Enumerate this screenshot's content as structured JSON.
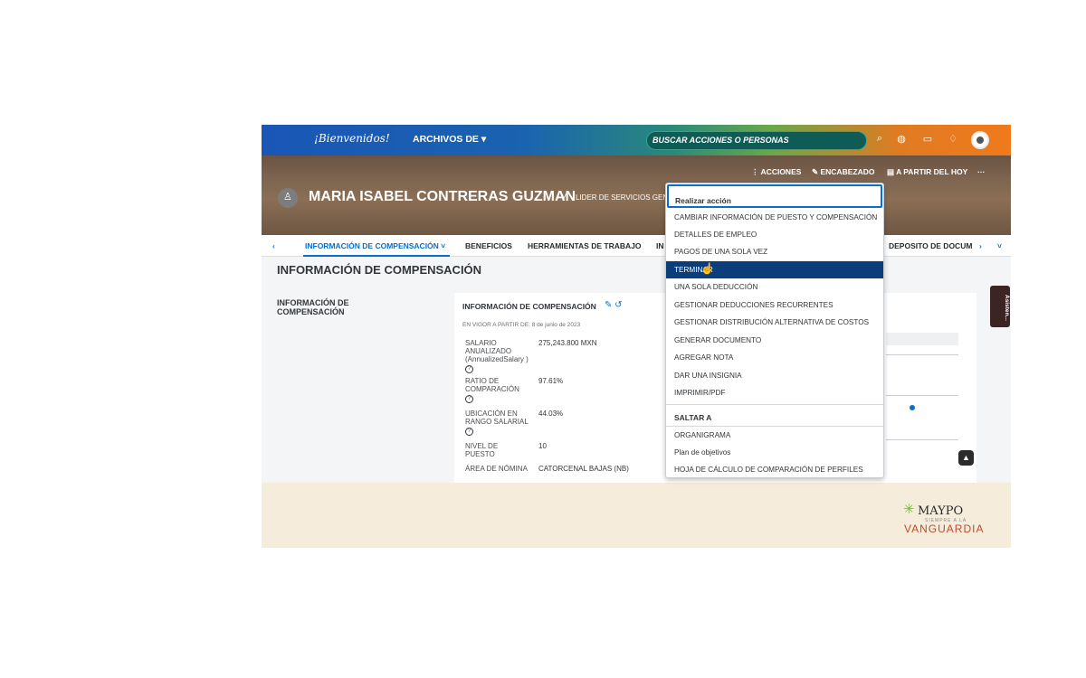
{
  "topbar": {
    "logo": "¡Bienvenidos!",
    "menu_label": "ARCHIVOS DE ▾",
    "search_placeholder": "BUSCAR ACCIONES O PERSONAS",
    "icons": [
      "search-icon",
      "chat-icon",
      "book-icon",
      "bell-icon",
      "user-avatar"
    ]
  },
  "header": {
    "actions_label": "⋮ ACCIONES",
    "encabezado_label": "✎ ENCABEZADO",
    "date_label": "▤ A PARTIR DEL HOY",
    "more_label": "···",
    "employee_name": "MARIA ISABEL CONTRERAS GUZMAN",
    "employee_role": "LIDER DE SERVICIOS GEN"
  },
  "tabs": {
    "prev": "‹",
    "items": [
      "INFORMACIÓN DE COMPENSACIÓN ˅",
      "BENEFICIOS",
      "HERRAMIENTAS DE TRABAJO",
      "IN",
      "DEPOSITO DE DOCUM"
    ],
    "next": "›",
    "expand": "˅"
  },
  "main": {
    "section_title": "INFORMACIÓN DE COMPENSACIÓN",
    "left_label": "INFORMACIÓN DE COMPENSACIÓN",
    "card": {
      "title": "INFORMACIÓN DE COMPENSACIÓN",
      "effective": "EN VIGOR A PARTIR DE: 8 de junio de 2023",
      "fields": [
        {
          "label": "SALARIO ANUALIZADO (AnnualizedSalary )",
          "value": "275,243.800 MXN"
        },
        {
          "label": "RATIO DE COMPARACIÓN",
          "value": "97.61%"
        },
        {
          "label": "UBICACIÓN EN RANGO SALARIAL",
          "value": "44.03%"
        },
        {
          "label": "NIVEL DE PUESTO",
          "value": "10"
        },
        {
          "label": "ÁREA DE NÓMINA",
          "value": "CATORCENAL BAJAS (NB)"
        }
      ]
    },
    "assistant_label": "Asisten..."
  },
  "menu": {
    "header": "Realizar acción",
    "items": [
      "CAMBIAR INFORMACIÓN DE PUESTO Y COMPENSACIÓN",
      "DETALLES DE EMPLEO",
      "PAGOS DE UNA SOLA VEZ",
      "TERMINAR",
      "UNA SOLA DEDUCCIÓN",
      "GESTIONAR DEDUCCIONES RECURRENTES",
      "GESTIONAR DISTRIBUCIÓN ALTERNATIVA DE COSTOS",
      "GENERAR DOCUMENTO",
      "AGREGAR NOTA",
      "DAR UNA INSIGNIA",
      "IMPRIMIR/PDF"
    ],
    "jump_header": "SALTAR A",
    "jump_items": [
      "ORGANIGRAMA",
      "Plan de objetivos",
      "HOJA DE CÁLCULO DE COMPARACIÓN DE PERFILES"
    ]
  },
  "footer": {
    "brand_top": "MAYPO",
    "brand_sub": "SIEMPRE A LA",
    "brand_bottom": "VANGUARDIA"
  }
}
